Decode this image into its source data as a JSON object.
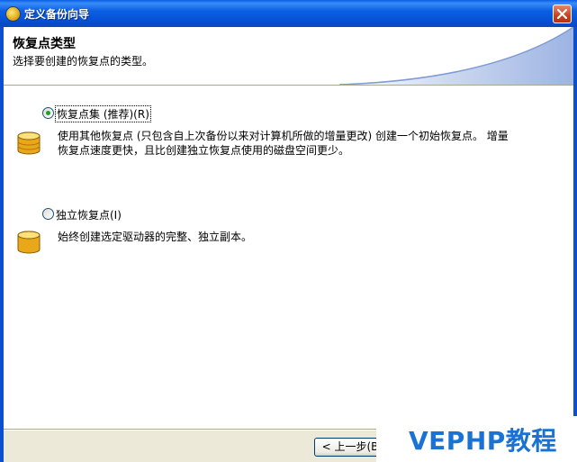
{
  "window": {
    "title": "定义备份向导"
  },
  "header": {
    "title": "恢复点类型",
    "subtitle": "选择要创建的恢复点的类型。"
  },
  "options": [
    {
      "label": "恢复点集 (推荐)(R)",
      "selected": true,
      "description_line1": "使用其他恢复点 (只包含自上次备份以来对计算机所做的增量更改) 创建一个初始恢复点。 增量",
      "description_line2": "恢复点速度更快，且比创建独立恢复点使用的磁盘空间更少。"
    },
    {
      "label": "独立恢复点(I)",
      "selected": false,
      "description_line1": "始终创建选定驱动器的完整、独立副本。"
    }
  ],
  "footer": {
    "back_label": "< 上一步(B"
  },
  "watermark": {
    "text": "VEPHP教程"
  },
  "colors": {
    "titlebar": "#0b5fe3",
    "accent_radio": "#21a121",
    "watermark": "#1a73d4"
  }
}
